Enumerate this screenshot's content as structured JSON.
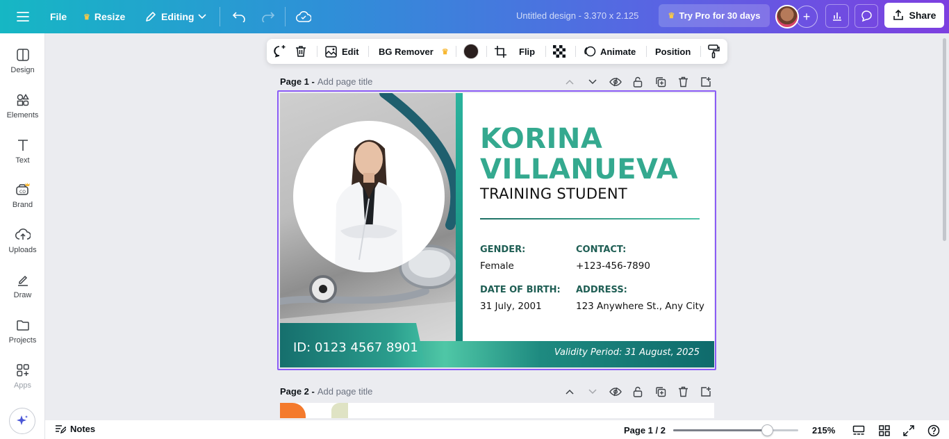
{
  "topbar": {
    "file_label": "File",
    "resize_label": "Resize",
    "editing_label": "Editing",
    "doc_title": "Untitled design - 3.370 x 2.125",
    "pro_label": "Try Pro for 30 days",
    "share_label": "Share"
  },
  "sidebar": {
    "items": [
      {
        "label": "Design",
        "icon": "design-icon"
      },
      {
        "label": "Elements",
        "icon": "elements-icon"
      },
      {
        "label": "Text",
        "icon": "text-icon"
      },
      {
        "label": "Brand",
        "icon": "brand-icon"
      },
      {
        "label": "Uploads",
        "icon": "uploads-icon"
      },
      {
        "label": "Draw",
        "icon": "draw-icon"
      },
      {
        "label": "Projects",
        "icon": "projects-icon"
      },
      {
        "label": "Apps",
        "icon": "apps-icon"
      }
    ]
  },
  "context_toolbar": {
    "edit_label": "Edit",
    "bg_remover_label": "BG Remover",
    "color": "#2a1f1e",
    "flip_label": "Flip",
    "animate_label": "Animate",
    "position_label": "Position"
  },
  "pages": [
    {
      "label": "Page 1 -",
      "title_placeholder": "Add page title"
    },
    {
      "label": "Page 2 -",
      "title_placeholder": "Add page title"
    }
  ],
  "card": {
    "first_name": "KORINA",
    "last_name": "VILLANUEVA",
    "role": "TRAINING STUDENT",
    "gender_label": "GENDER:",
    "gender_value": "Female",
    "contact_label": "CONTACT:",
    "contact_value": "+123-456-7890",
    "dob_label": "DATE OF BIRTH:",
    "dob_value": "31 July, 2001",
    "address_label": "ADDRESS:",
    "address_value": "123 Anywhere St., Any City",
    "id_text": "ID: 0123 4567 8901",
    "validity_text": "Validity Period: 31 August, 2025",
    "accent_color": "#34a98f"
  },
  "bottombar": {
    "notes_label": "Notes",
    "page_indicator": "Page 1 / 2",
    "zoom_label": "215%",
    "zoom_fraction": 0.75
  }
}
